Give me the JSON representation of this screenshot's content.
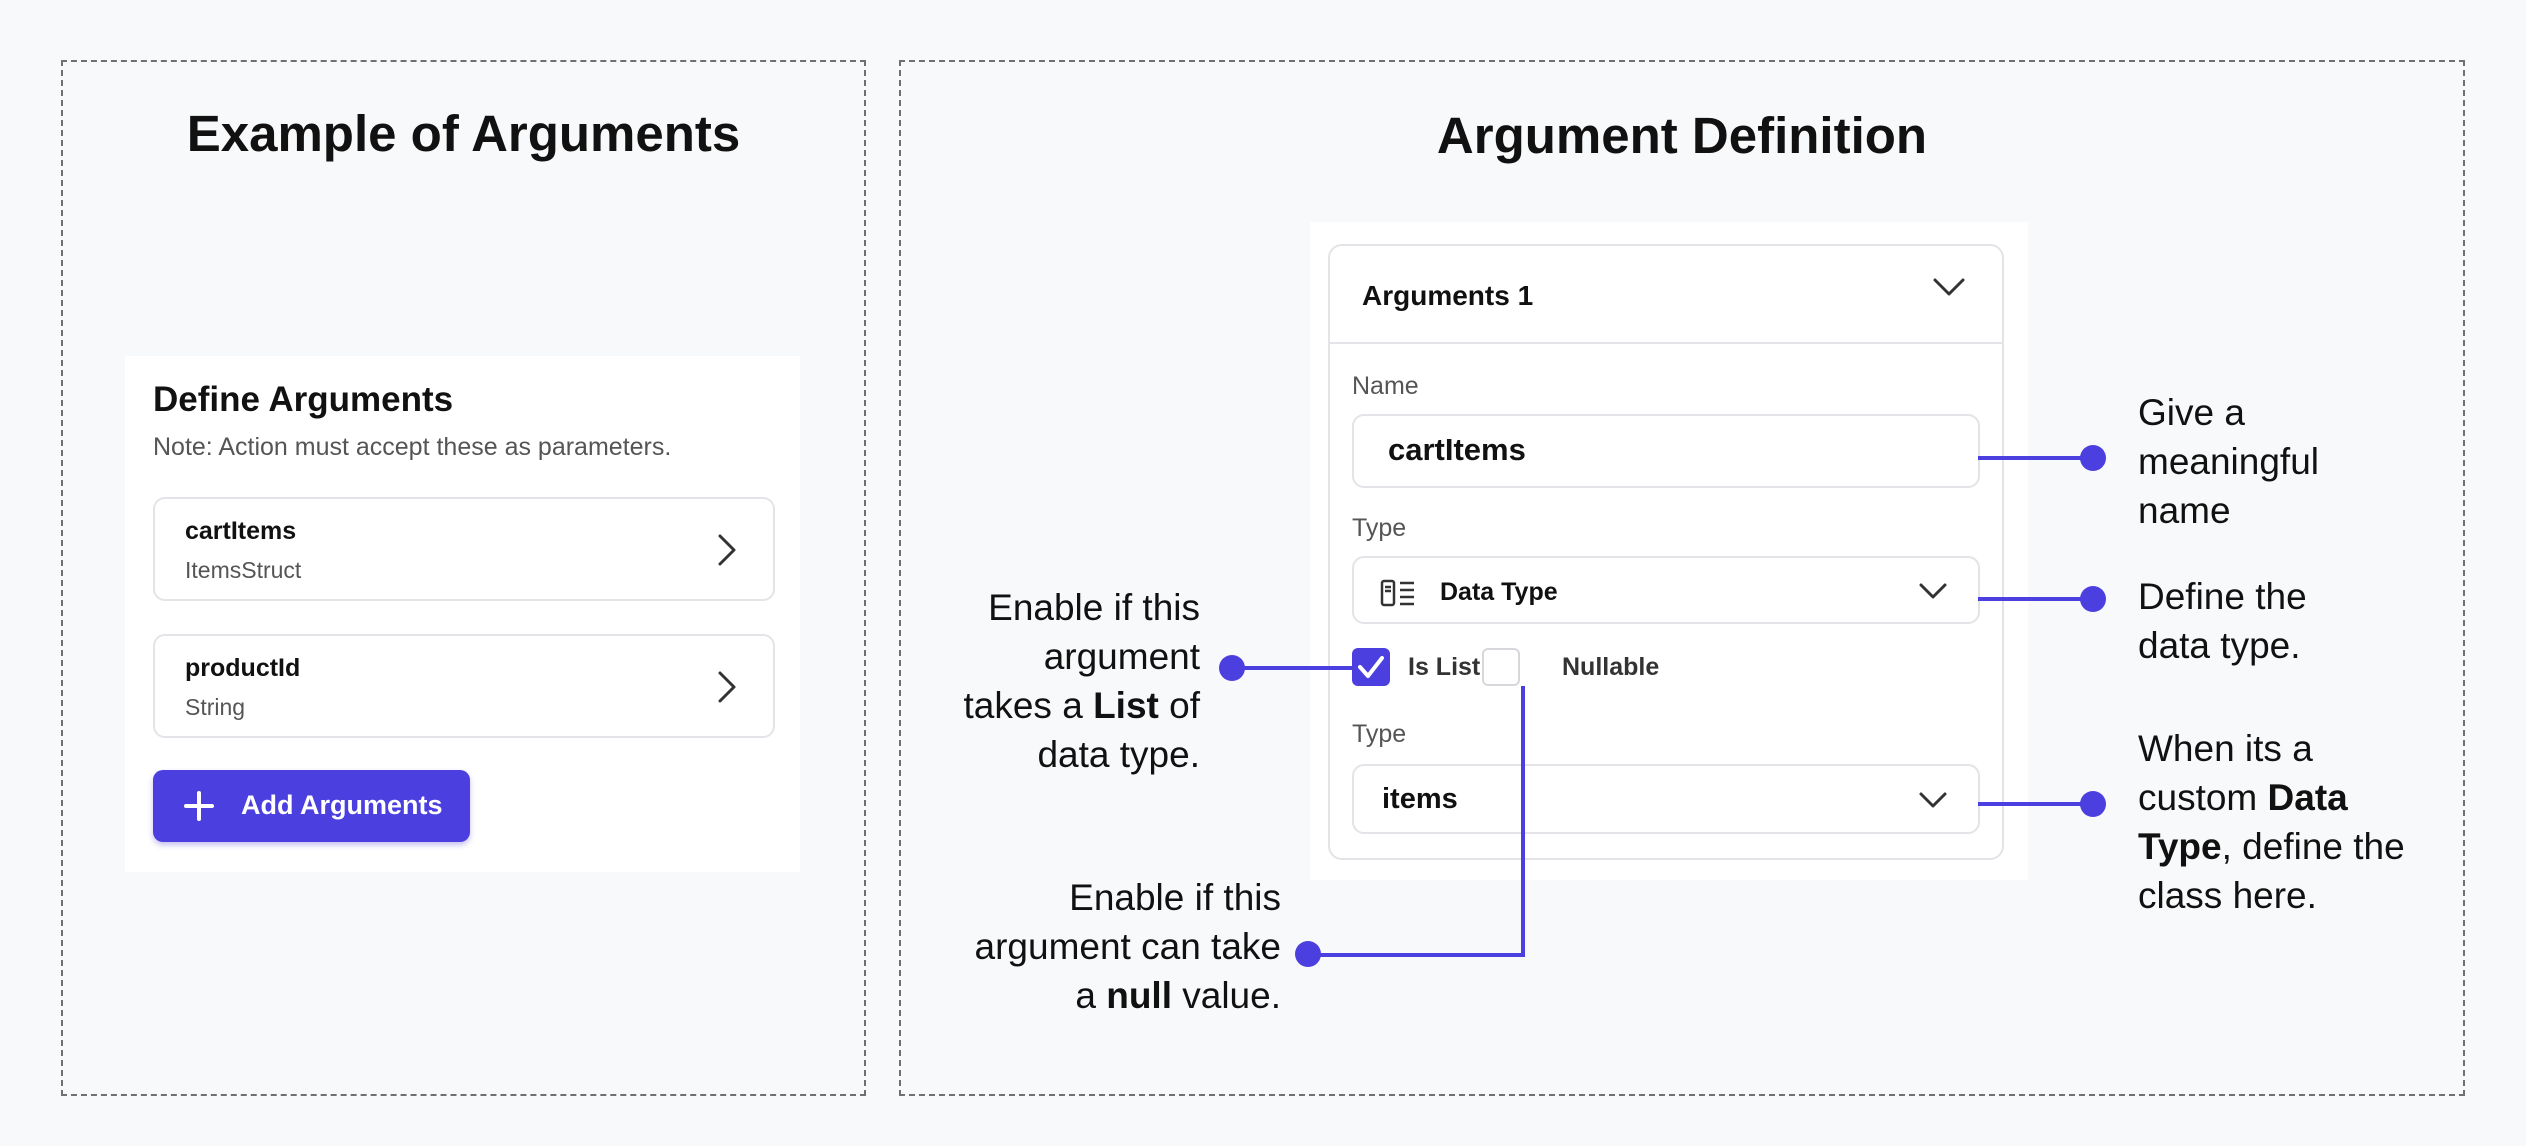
{
  "left_panel": {
    "title": "Example of Arguments",
    "card": {
      "title": "Define Arguments",
      "note": "Note: Action must accept these as parameters.",
      "arguments": [
        {
          "name": "cartItems",
          "type": "ItemsStruct"
        },
        {
          "name": "productId",
          "type": "String"
        }
      ],
      "add_button": "Add Arguments"
    }
  },
  "right_panel": {
    "title": "Argument Definition",
    "form": {
      "header": "Arguments 1",
      "name_label": "Name",
      "name_value": "cartItems",
      "type_label": "Type",
      "type_value": "Data Type",
      "is_list_label": "Is List",
      "is_list_checked": true,
      "nullable_label": "Nullable",
      "nullable_checked": false,
      "type2_label": "Type",
      "type2_value": "items"
    },
    "annotations": {
      "name": [
        "Give a",
        "meaningful",
        "name"
      ],
      "data_type": [
        "Define the",
        "data type."
      ],
      "custom_type": {
        "l1": "When its a",
        "l2a": "custom ",
        "l2b": "Data",
        "l3a": "Type",
        "l3b": ", define the",
        "l4": "class here."
      },
      "list": {
        "l1": "Enable if this",
        "l2": "argument",
        "l3a": "takes a ",
        "l3b": "List",
        "l3c": " of",
        "l4": "data type."
      },
      "nullable": {
        "l1": "Enable if this",
        "l2": "argument can take",
        "l3a": "a ",
        "l3b": "null",
        "l3c": " value."
      }
    }
  },
  "colors": {
    "accent": "#4b3fe0",
    "background": "#f8f9fa"
  },
  "icons": [
    "chevron-right-icon",
    "chevron-down-icon",
    "plus-icon",
    "data-type-icon",
    "checkmark-icon"
  ]
}
